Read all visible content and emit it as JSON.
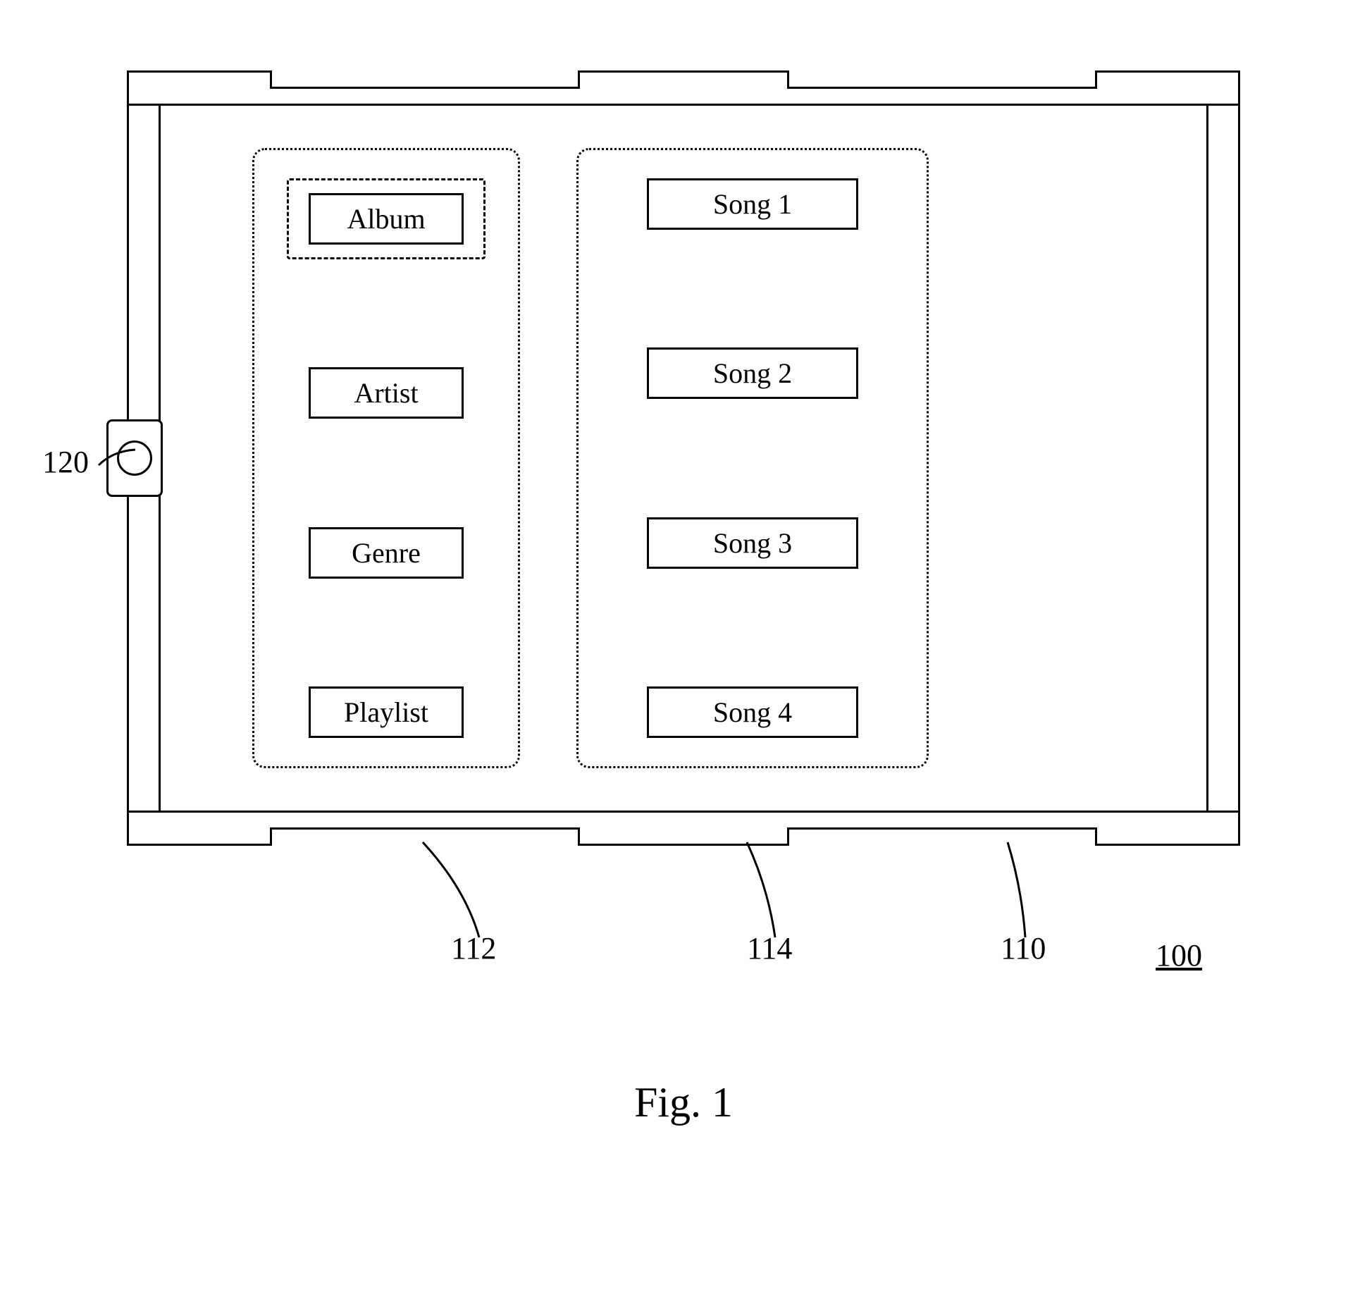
{
  "figure": {
    "caption": "Fig. 1"
  },
  "refs": {
    "device": "100",
    "screen": "110",
    "nav_panel": "112",
    "list_panel": "114",
    "side_control": "120"
  },
  "nav": {
    "items": [
      {
        "label": "Album",
        "selected": true
      },
      {
        "label": "Artist",
        "selected": false
      },
      {
        "label": "Genre",
        "selected": false
      },
      {
        "label": "Playlist",
        "selected": false
      }
    ]
  },
  "songs": {
    "items": [
      {
        "label": "Song 1"
      },
      {
        "label": "Song 2"
      },
      {
        "label": "Song 3"
      },
      {
        "label": "Song 4"
      }
    ]
  }
}
